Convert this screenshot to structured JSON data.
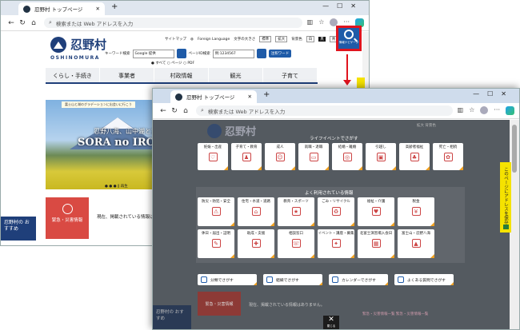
{
  "win1": {
    "tab_title": "忍野村 トップページ",
    "address_placeholder": "検索または Web アドレスを入力",
    "site": {
      "logo_jp": "忍野村",
      "logo_en": "OSHINOMURA",
      "util": {
        "sitemap": "サイトマップ",
        "foreign": "Foreign Language",
        "font_size": "文字の大きさ",
        "std": "標準",
        "large": "拡大",
        "bg": "背景色",
        "white": "白",
        "black": "黒",
        "blue": "青"
      },
      "keyword_label": "キーワード検索",
      "keyword_value": "Google 提供",
      "page_id_label": "ページID検索",
      "page_id_placeholder": "例:1234567",
      "note_button": "注釈ワード",
      "radios": "● すべて ○ ページ ○ PDF",
      "uv_button_label": "情報ナビゲータ"
    },
    "gnav": [
      "くらし・手続き",
      "事業者",
      "村政情報",
      "観光",
      "子育て"
    ],
    "hero": {
      "banner": "富士山と湖のグラデーションに出会いに行こう",
      "title_small": "忍野八海、山中湖と富士山",
      "title_big": "SORA no IRO"
    },
    "carousel": "● ● ●  ‖ 再生",
    "emergency_label": "緊急・災害情報",
    "emergency_text": "現在、掲載されている情報はありません。",
    "side_label": "忍野村の\nおすすめ"
  },
  "win2": {
    "tab_title": "忍野村 トップページ",
    "address_placeholder": "検索または Web アドレスを入力",
    "logo_jp": "忍野村",
    "util": "拡大 背景色",
    "section1_title": "ライフイベントでさがす",
    "life_events": [
      {
        "label": "妊娠・出産",
        "icon": "♡"
      },
      {
        "label": "子育て・教育",
        "icon": "♟"
      },
      {
        "label": "成人",
        "icon": "☺"
      },
      {
        "label": "就職・退職",
        "icon": "▭"
      },
      {
        "label": "結婚・離婚",
        "icon": "◎"
      },
      {
        "label": "引越し",
        "icon": "▣"
      },
      {
        "label": "高齢者福祉",
        "icon": "♣"
      },
      {
        "label": "死亡・相続",
        "icon": "✿"
      }
    ],
    "section2_title": "よく利用されている情報",
    "popular": [
      {
        "label": "防災・防犯・安全",
        "icon": "⚠"
      },
      {
        "label": "住宅・水道・道路",
        "icon": "⌂"
      },
      {
        "label": "教育・スポーツ",
        "icon": "★"
      },
      {
        "label": "ごみ・リサイクル",
        "icon": "♻"
      },
      {
        "label": "福祉・介護",
        "icon": "♥"
      },
      {
        "label": "税金",
        "icon": "¥"
      },
      {
        "label": "",
        "icon": ""
      },
      {
        "label": "休日・届出・証明",
        "icon": "✎"
      },
      {
        "label": "助成・支援",
        "icon": "✚"
      },
      {
        "label": "相談窓口",
        "icon": "☏"
      },
      {
        "label": "イベント・講座・募集",
        "icon": "✦"
      },
      {
        "label": "北富士演習場入会日",
        "icon": "▦"
      },
      {
        "label": "富士山・忍野八海",
        "icon": "▲"
      },
      {
        "label": "",
        "icon": ""
      }
    ],
    "bottom_buttons": [
      "分類でさがす",
      "組織でさがす",
      "カレンダーでさがす",
      "よくある質問でさがす"
    ],
    "close_label": "閉じる",
    "emergency_label": "緊急・災害情報",
    "emergency_text": "現在、掲載されている情報はありません。",
    "links": "緊急・災害情報一覧   緊急・災害情報一覧",
    "side_label": "忍野村の\nおすすめ",
    "side_tab": "このページにアドレスを保存"
  },
  "colors": {
    "accent": "#1f5ba8",
    "highlight": "#e0141e",
    "emergency": "#d94a43",
    "side_tab": "#f5e200"
  }
}
